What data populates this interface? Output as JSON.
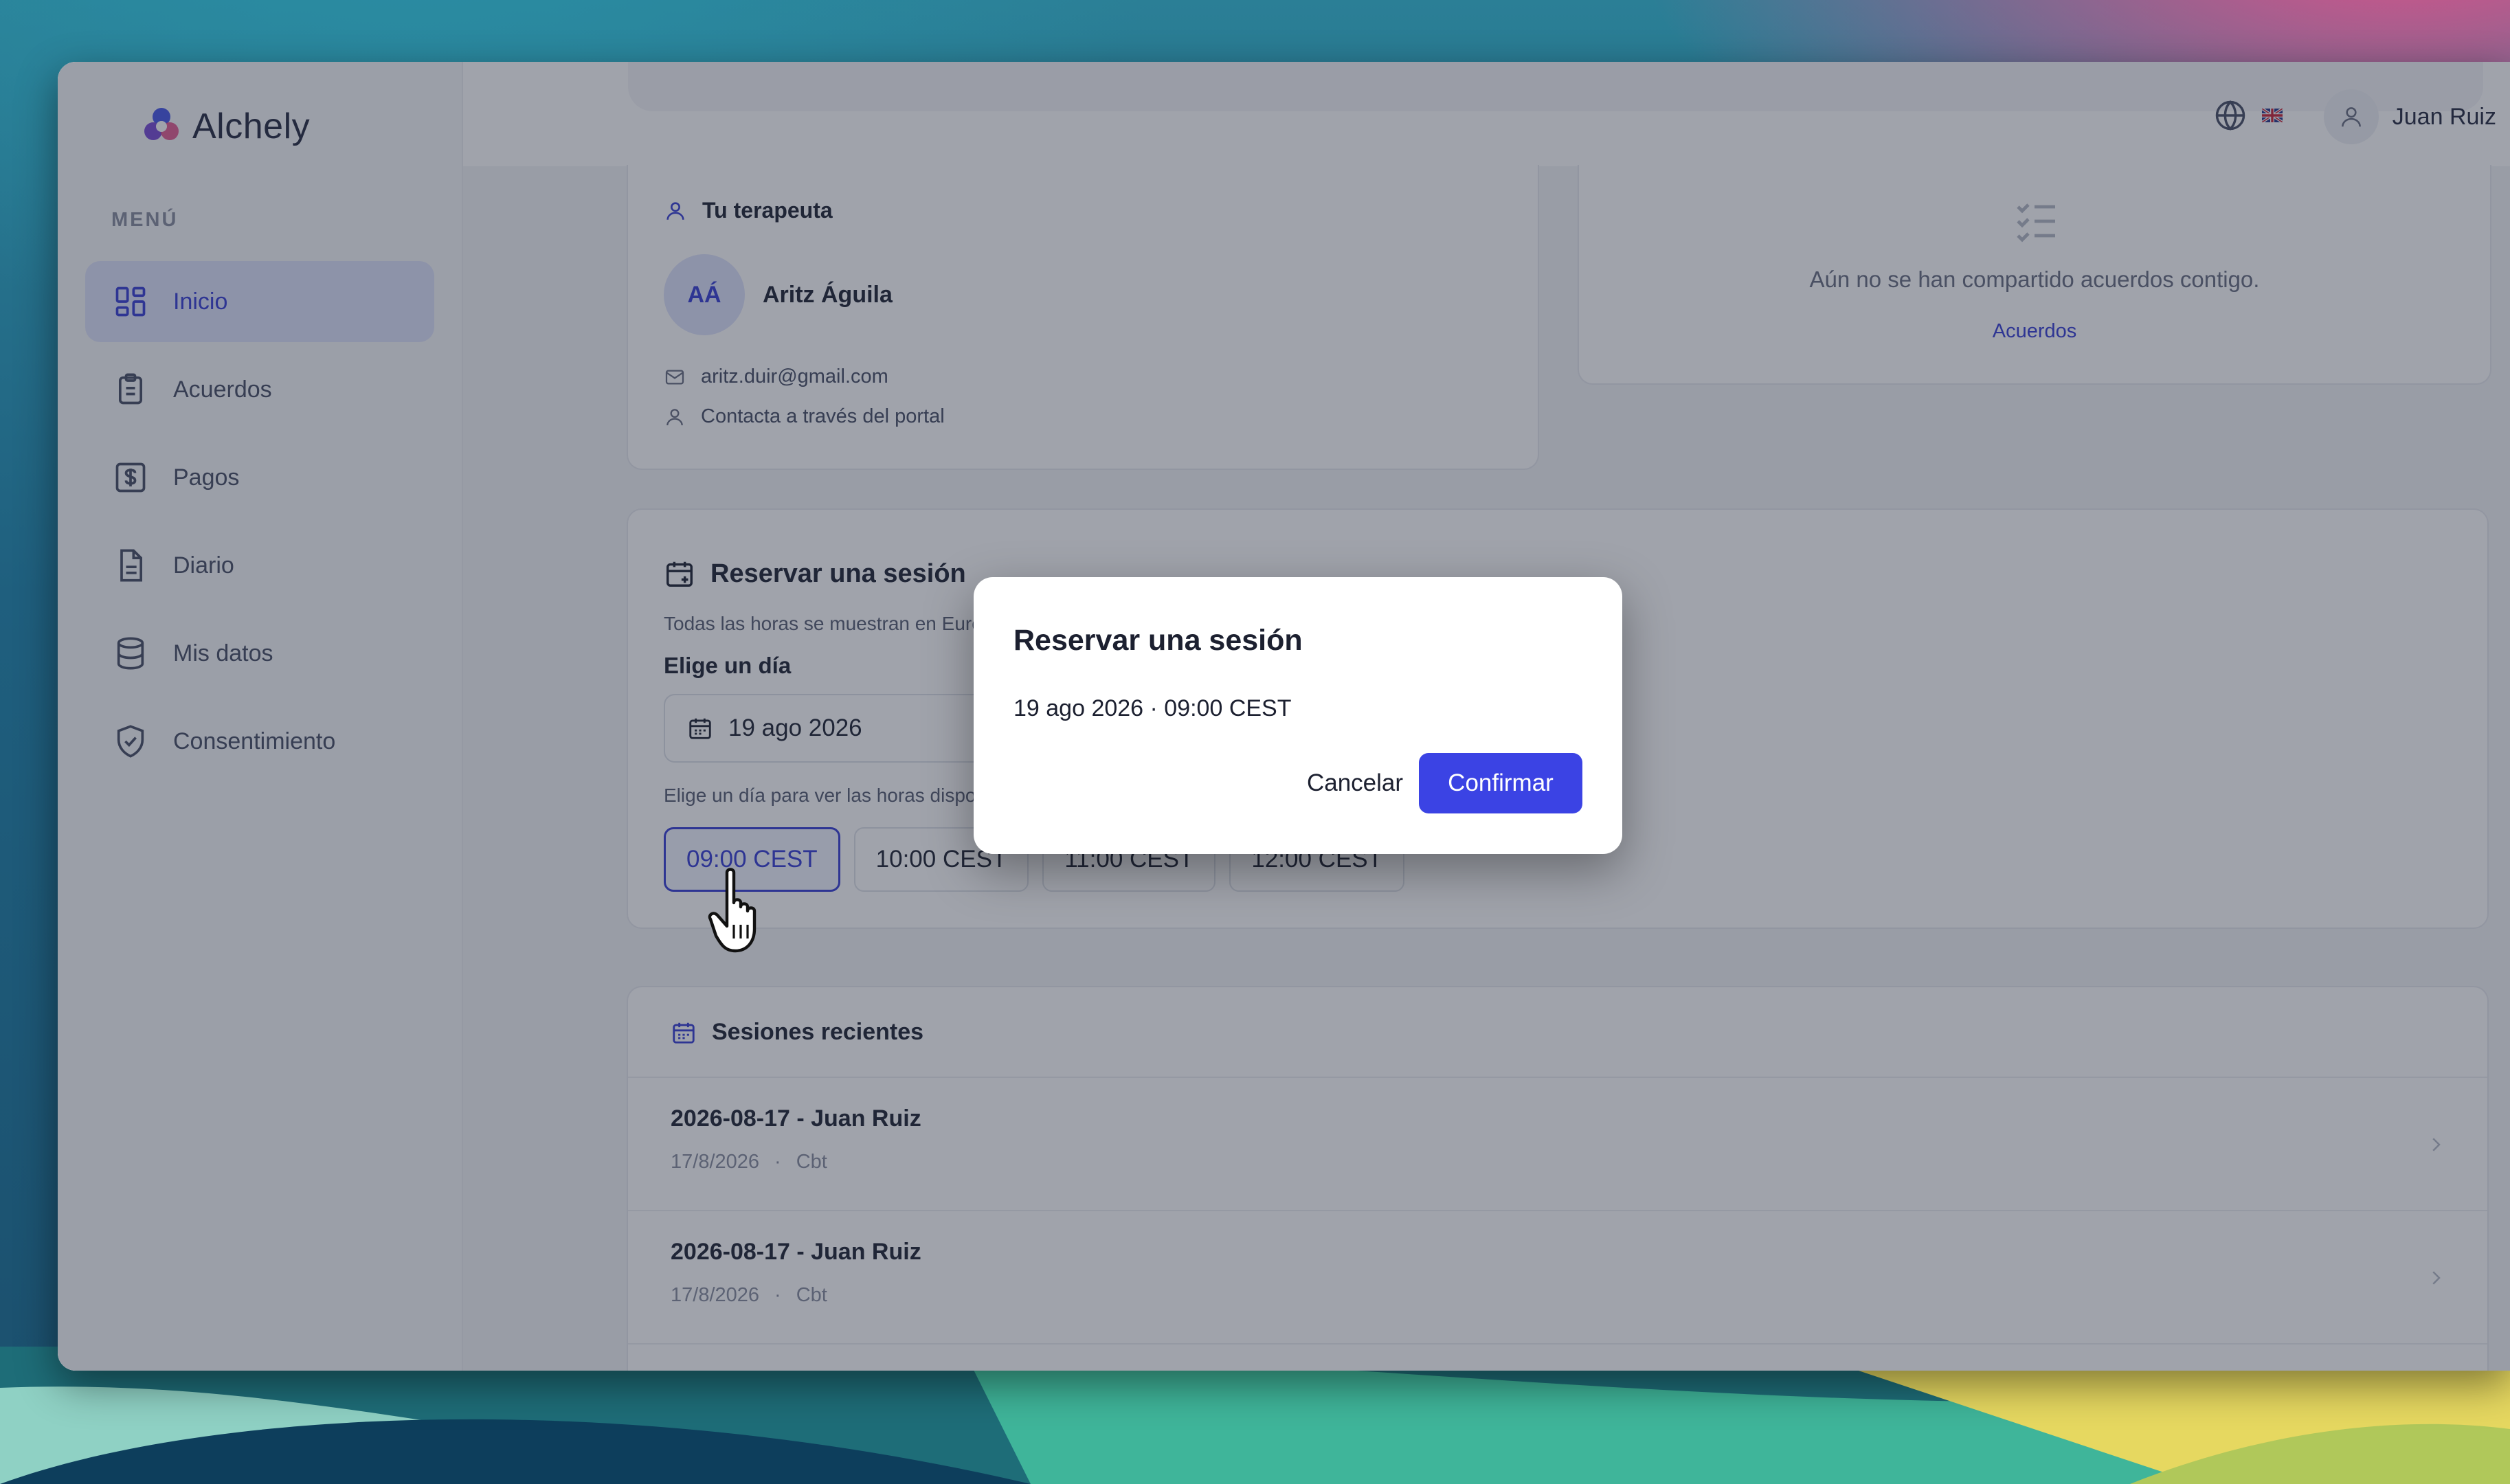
{
  "app": {
    "name": "Alchely"
  },
  "header": {
    "user_name": "Juan Ruiz"
  },
  "sidebar": {
    "heading": "MENÚ",
    "items": [
      {
        "label": "Inicio",
        "icon": "dashboard-icon",
        "active": true
      },
      {
        "label": "Acuerdos",
        "icon": "clipboard-icon",
        "active": false
      },
      {
        "label": "Pagos",
        "icon": "dollar-icon",
        "active": false
      },
      {
        "label": "Diario",
        "icon": "document-icon",
        "active": false
      },
      {
        "label": "Mis datos",
        "icon": "database-icon",
        "active": false
      },
      {
        "label": "Consentimiento",
        "icon": "shield-check-icon",
        "active": false
      }
    ]
  },
  "therapist": {
    "title": "Tu terapeuta",
    "initials": "AÁ",
    "name": "Aritz Águila",
    "email": "aritz.duir@gmail.com",
    "contact_note": "Contacta a través del portal"
  },
  "agreements": {
    "empty_text": "Aún no se han compartido acuerdos contigo.",
    "link": "Acuerdos"
  },
  "booking": {
    "title": "Reservar una sesión",
    "timezone_note": "Todas las horas se muestran en Europe/M",
    "day_label": "Elige un día",
    "date_value": "19 ago 2026",
    "day_hint": "Elige un día para ver las horas disponibles",
    "slots": [
      {
        "label": "09:00 CEST",
        "selected": true
      },
      {
        "label": "10:00 CEST",
        "selected": false
      },
      {
        "label": "11:00 CEST",
        "selected": false
      },
      {
        "label": "12:00 CEST",
        "selected": false
      }
    ]
  },
  "sessions": {
    "title": "Sesiones recientes",
    "items": [
      {
        "title": "2026-08-17 - Juan Ruiz",
        "date": "17/8/2026",
        "separator": "·",
        "type": "Cbt"
      },
      {
        "title": "2026-08-17 - Juan Ruiz",
        "date": "17/8/2026",
        "separator": "·",
        "type": "Cbt"
      }
    ]
  },
  "modal": {
    "title": "Reservar una sesión",
    "detail": "19 ago 2026 · 09:00 CEST",
    "cancel_label": "Cancelar",
    "confirm_label": "Confirmar"
  },
  "colors": {
    "accent": "#3b43e4",
    "active_nav_bg": "#dfe3fb",
    "overlay": "rgba(28,36,56,0.42)"
  }
}
